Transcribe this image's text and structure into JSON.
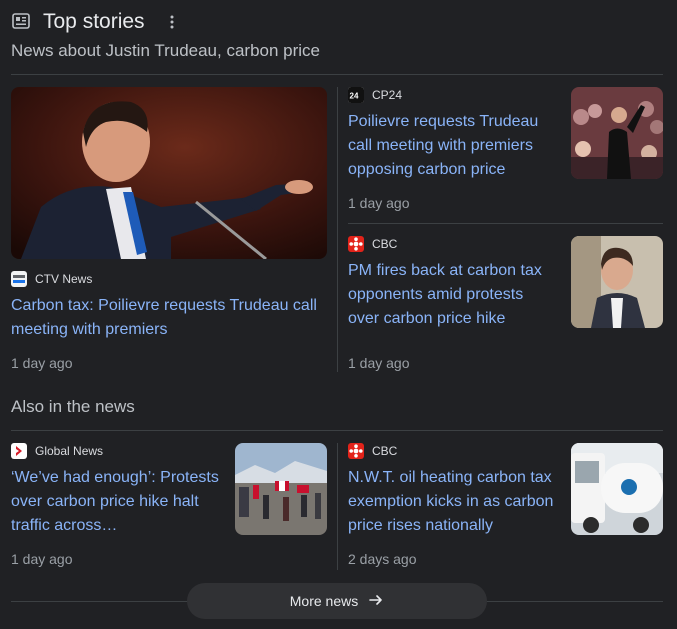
{
  "header": {
    "title": "Top stories",
    "subtitle": "News about Justin Trudeau, carbon price"
  },
  "stories": [
    {
      "source": "CTV News",
      "headline": "Carbon tax: Poilievre requests Trudeau call meeting with premiers",
      "time": "1 day ago"
    },
    {
      "source": "CP24",
      "headline": "Poilievre requests Trudeau call meeting with premiers opposing carbon price",
      "time": "1 day ago"
    },
    {
      "source": "CBC",
      "headline": "PM fires back at carbon tax opponents amid protests over carbon price hike",
      "time": "1 day ago"
    }
  ],
  "also": {
    "title": "Also in the news",
    "items": [
      {
        "source": "Global News",
        "headline": "‘We’ve had enough’: Protests over carbon price hike halt traffic across…",
        "time": "1 day ago"
      },
      {
        "source": "CBC",
        "headline": "N.W.T. oil heating carbon tax exemption kicks in as carbon price rises nationally",
        "time": "2 days ago"
      }
    ]
  },
  "more_button": {
    "label": "More news"
  },
  "colors": {
    "background": "#202124",
    "link": "#8ab4f8",
    "muted": "#9aa0a6",
    "divider": "#3c4043"
  }
}
